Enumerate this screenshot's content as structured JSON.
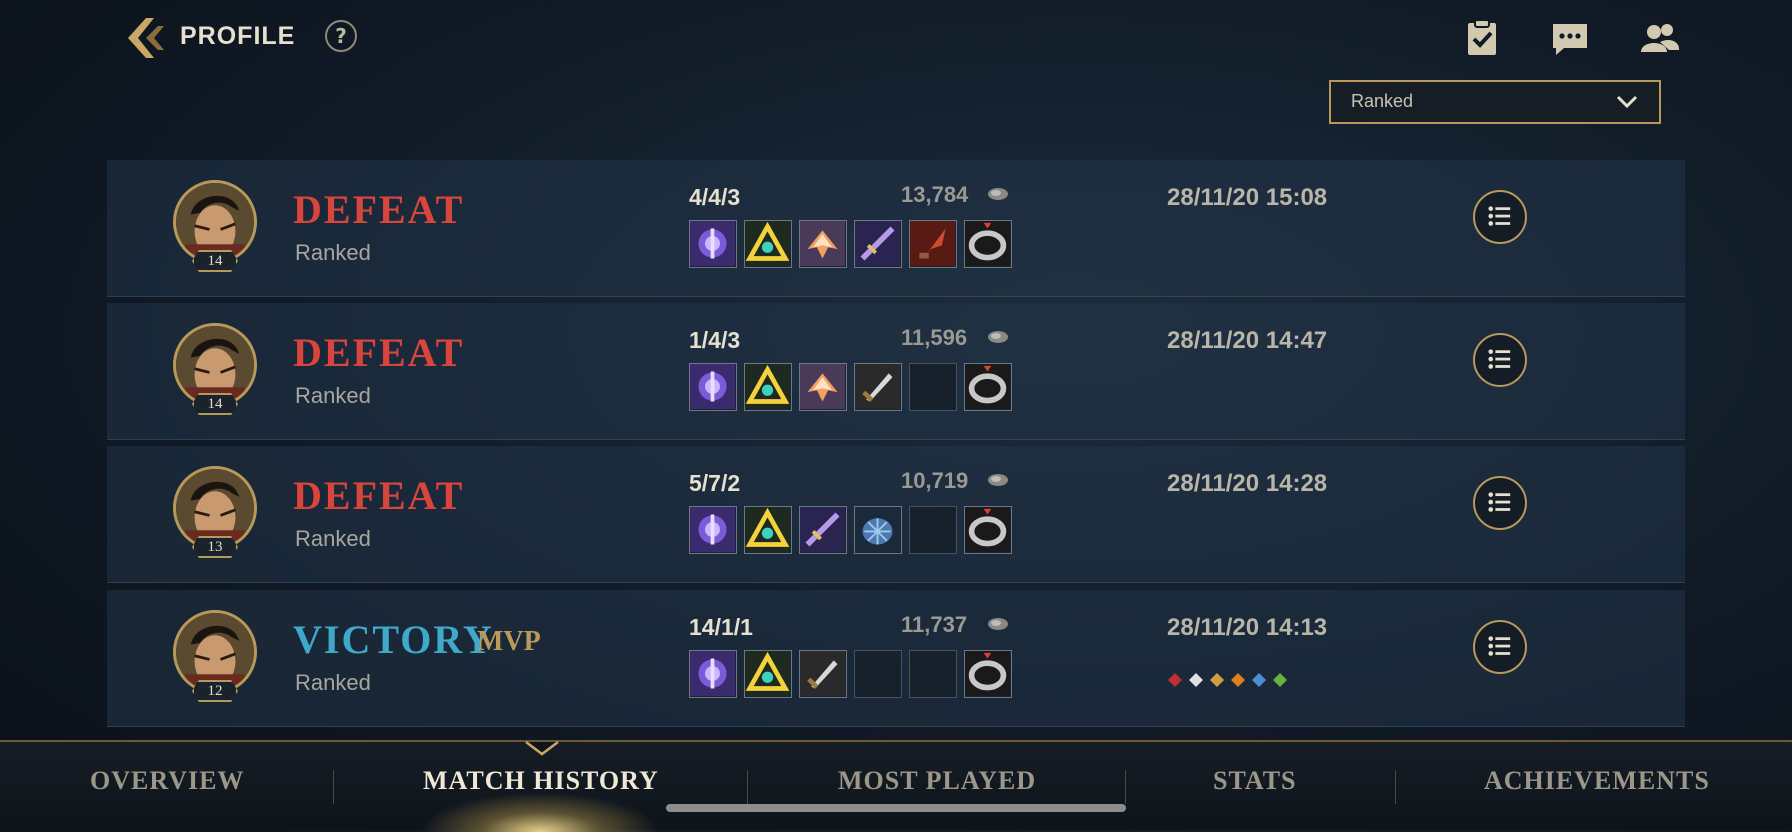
{
  "header": {
    "title": "PROFILE",
    "help": "?",
    "icons": [
      "missions-icon",
      "chat-icon",
      "friends-icon"
    ]
  },
  "filter": {
    "selected": "Ranked"
  },
  "matches": [
    {
      "result": "DEFEAT",
      "mode": "Ranked",
      "level": "14",
      "kda": "4/4/3",
      "gold": "13,784",
      "date": "28/11/20 15:08",
      "mvp": ""
    },
    {
      "result": "DEFEAT",
      "mode": "Ranked",
      "level": "14",
      "kda": "1/4/3",
      "gold": "11,596",
      "date": "28/11/20 14:47",
      "mvp": ""
    },
    {
      "result": "DEFEAT",
      "mode": "Ranked",
      "level": "13",
      "kda": "5/7/2",
      "gold": "10,719",
      "date": "28/11/20 14:28",
      "mvp": ""
    },
    {
      "result": "VICTORY",
      "mode": "Ranked",
      "level": "12",
      "kda": "14/1/1",
      "gold": "11,737",
      "date": "28/11/20 14:13",
      "mvp": "MVP"
    }
  ],
  "nav": {
    "tabs": [
      "OVERVIEW",
      "MATCH HISTORY",
      "MOST PLAYED",
      "STATS",
      "ACHIEVEMENTS"
    ],
    "active": "MATCH HISTORY"
  },
  "colors": {
    "defeat": "#d8453c",
    "victory": "#40a8c9",
    "gold_accent": "#b79a5b"
  }
}
